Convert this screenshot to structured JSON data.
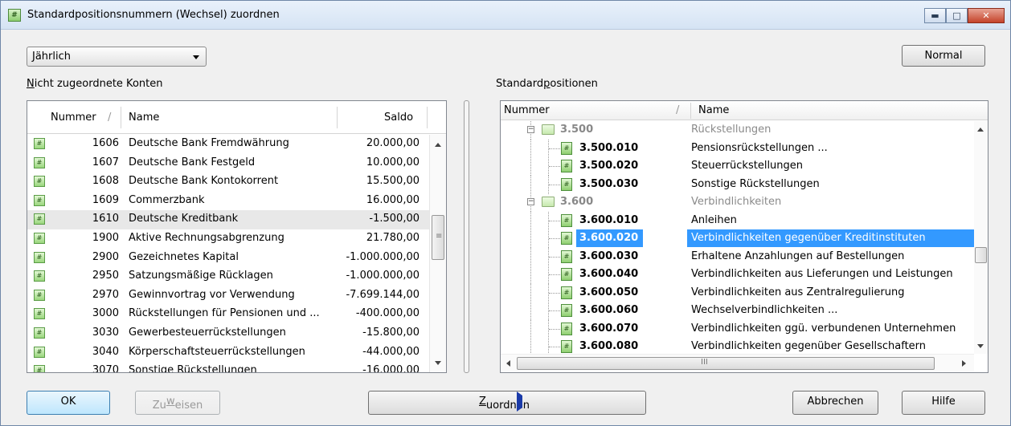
{
  "window": {
    "title": "Standardpositionsnummern (Wechsel) zuordnen"
  },
  "period": {
    "selected": "Jährlich"
  },
  "buttons": {
    "normal": "Normal",
    "ok": "OK",
    "zuweisen_pre": "Zu",
    "zuweisen_u": "w",
    "zuweisen_post": "eisen",
    "zuordnen_u": "Z",
    "zuordnen_post": "uordnen",
    "abbrechen": "Abbrechen",
    "hilfe": "Hilfe"
  },
  "left": {
    "label_u": "N",
    "label_post": "icht zugeordnete Konten",
    "columns": {
      "nummer": "Nummer",
      "sort": "/",
      "name": "Name",
      "saldo": "Saldo"
    },
    "rows": [
      {
        "nr": "1606",
        "name": "Deutsche Bank Fremdwährung",
        "saldo": "20.000,00"
      },
      {
        "nr": "1607",
        "name": "Deutsche Bank Festgeld",
        "saldo": "10.000,00"
      },
      {
        "nr": "1608",
        "name": "Deutsche Bank Kontokorrent",
        "saldo": "15.500,00"
      },
      {
        "nr": "1609",
        "name": "Commerzbank",
        "saldo": "16.000,00"
      },
      {
        "nr": "1610",
        "name": "Deutsche Kreditbank",
        "saldo": "-1.500,00"
      },
      {
        "nr": "1900",
        "name": "Aktive Rechnungsabgrenzung",
        "saldo": "21.780,00"
      },
      {
        "nr": "2900",
        "name": "Gezeichnetes Kapital",
        "saldo": "-1.000.000,00"
      },
      {
        "nr": "2950",
        "name": "Satzungsmäßige Rücklagen",
        "saldo": "-1.000.000,00"
      },
      {
        "nr": "2970",
        "name": "Gewinnvortrag vor Verwendung",
        "saldo": "-7.699.144,00"
      },
      {
        "nr": "3000",
        "name": "Rückstellungen für Pensionen und ...",
        "saldo": "-400.000,00"
      },
      {
        "nr": "3030",
        "name": "Gewerbesteuerrückstellungen",
        "saldo": "-15.800,00"
      },
      {
        "nr": "3040",
        "name": "Körperschaftsteuerrückstellungen",
        "saldo": "-44.000,00"
      },
      {
        "nr": "3070",
        "name": "Sonstige Rückstellungen",
        "saldo": "-16.000,00"
      }
    ]
  },
  "right": {
    "label_pre": "Standard",
    "label_u": "p",
    "label_post": "ositionen",
    "columns": {
      "nummer": "Nummer",
      "sort": "/",
      "name": "Name"
    },
    "rows": [
      {
        "nr": "3.500",
        "name": "Rückstellungen",
        "group": true
      },
      {
        "nr": "3.500.010",
        "name": "Pensionsrückstellungen ..."
      },
      {
        "nr": "3.500.020",
        "name": "Steuerrückstellungen"
      },
      {
        "nr": "3.500.030",
        "name": "Sonstige Rückstellungen"
      },
      {
        "nr": "3.600",
        "name": "Verbindlichkeiten",
        "group": true
      },
      {
        "nr": "3.600.010",
        "name": "Anleihen"
      },
      {
        "nr": "3.600.020",
        "name": "Verbindlichkeiten gegenüber Kreditinstituten"
      },
      {
        "nr": "3.600.030",
        "name": "Erhaltene Anzahlungen auf Bestellungen"
      },
      {
        "nr": "3.600.040",
        "name": "Verbindlichkeiten aus Lieferungen und Leistungen"
      },
      {
        "nr": "3.600.050",
        "name": "Verbindlichkeiten aus Zentralregulierung"
      },
      {
        "nr": "3.600.060",
        "name": "Wechselverbindlichkeiten ..."
      },
      {
        "nr": "3.600.070",
        "name": "Verbindlichkeiten ggü. verbundenen Unternehmen"
      },
      {
        "nr": "3.600.080",
        "name": "Verbindlichkeiten gegenüber Gesellschaftern"
      }
    ],
    "hscroll_grip": "III"
  }
}
